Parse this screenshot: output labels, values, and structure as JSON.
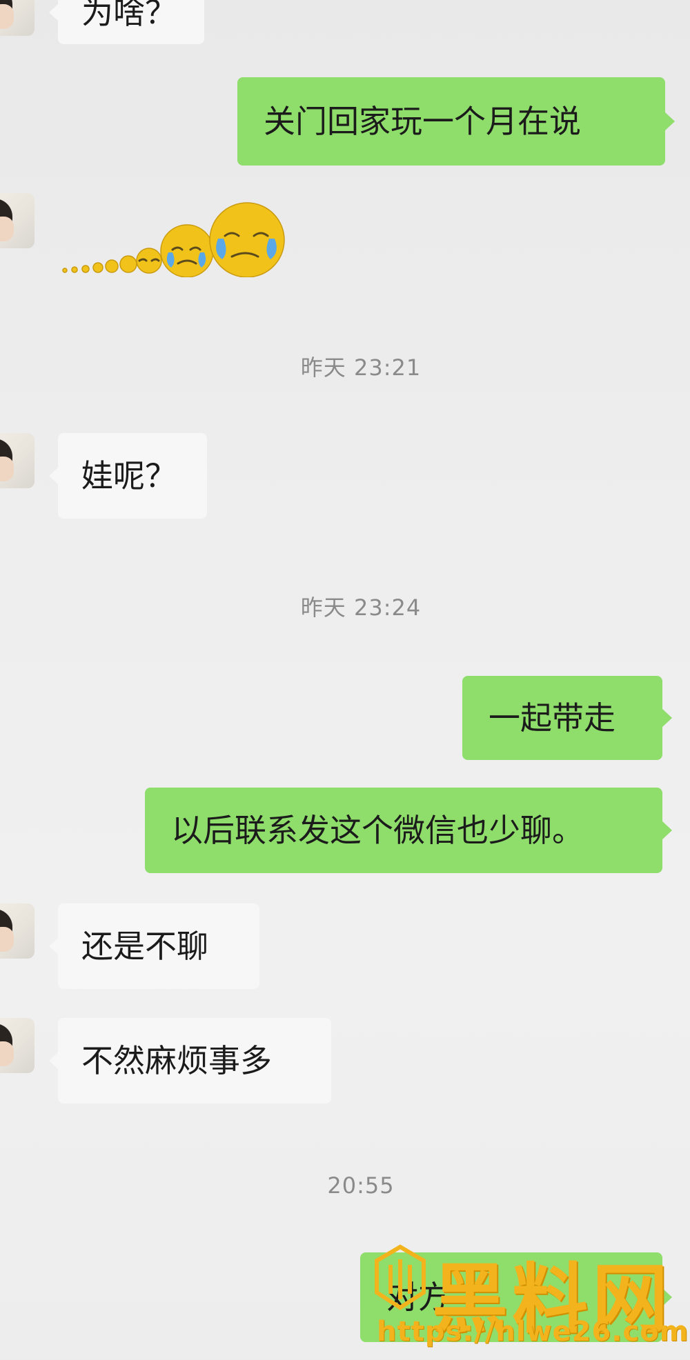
{
  "messages": {
    "top_partial": "为啥？",
    "m1": "关门回家玩一个月在说",
    "m3": "娃呢？",
    "m4": "一起带走",
    "m5": "以后联系发这个微信也少聊。",
    "m6": "还是不聊",
    "m7": "不然麻烦事多",
    "m8_partial": "对方"
  },
  "timestamps": {
    "t1": "昨天 23:21",
    "t2": "昨天 23:24",
    "t3": "20:55"
  },
  "emojis": {
    "m2": "crying-face-trail-icon"
  },
  "watermark": {
    "brand": "黑料网",
    "url": "https://hlwe26.com"
  },
  "colors": {
    "background": "#eeeeee",
    "incoming_bubble": "#f7f7f7",
    "outgoing_bubble": "#8fdd6b",
    "timestamp_text": "#8a8a8a",
    "watermark": "#f3b31d"
  }
}
